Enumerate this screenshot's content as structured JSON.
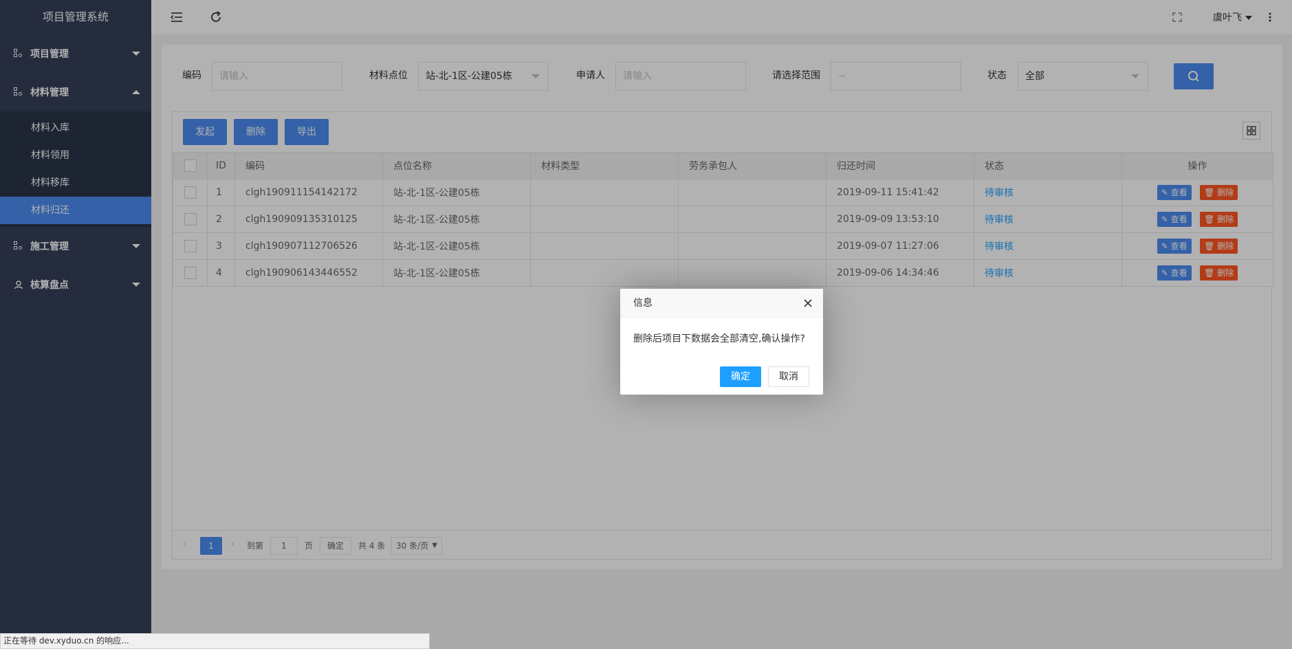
{
  "app": {
    "title": "项目管理系统"
  },
  "sidebar": {
    "groups": [
      {
        "label": "项目管理"
      },
      {
        "label": "材料管理"
      },
      {
        "label": "施工管理"
      },
      {
        "label": "核算盘点"
      }
    ],
    "sub_items": [
      {
        "label": "材料入库"
      },
      {
        "label": "材料领用"
      },
      {
        "label": "材料移库"
      },
      {
        "label": "材料归还"
      }
    ]
  },
  "header": {
    "user": "虞叶飞"
  },
  "filters": {
    "code_label": "编码",
    "code_placeholder": "请输入",
    "location_label": "材料点位",
    "location_value": "站-北-1区-公建05栋",
    "applicant_label": "申请人",
    "applicant_placeholder": "请输入",
    "range_label": "请选择范围",
    "range_placeholder": "~",
    "status_label": "状态",
    "status_value": "全部"
  },
  "toolbar": {
    "start": "发起",
    "delete": "删除",
    "export": "导出"
  },
  "table": {
    "headers": [
      "ID",
      "编码",
      "点位名称",
      "材料类型",
      "劳务承包人",
      "归还时间",
      "状态",
      "操作"
    ],
    "rows": [
      {
        "id": "1",
        "code": "clgh190911154142172",
        "location": "站-北-1区-公建05栋",
        "type": "",
        "contractor": "",
        "time": "2019-09-11 15:41:42",
        "status": "待审核"
      },
      {
        "id": "2",
        "code": "clgh190909135310125",
        "location": "站-北-1区-公建05栋",
        "type": "",
        "contractor": "",
        "time": "2019-09-09 13:53:10",
        "status": "待审核"
      },
      {
        "id": "3",
        "code": "clgh190907112706526",
        "location": "站-北-1区-公建05栋",
        "type": "",
        "contractor": "",
        "time": "2019-09-07 11:27:06",
        "status": "待审核"
      },
      {
        "id": "4",
        "code": "clgh190906143446552",
        "location": "站-北-1区-公建05栋",
        "type": "",
        "contractor": "",
        "time": "2019-09-06 14:34:46",
        "status": "待审核"
      }
    ],
    "view_label": "查看",
    "delete_label": "删除"
  },
  "pager": {
    "current": "1",
    "goto_label": "到第",
    "goto_value": "1",
    "page_unit": "页",
    "confirm": "确定",
    "total": "共 4 条",
    "per_page": "30 条/页"
  },
  "dialog": {
    "title": "信息",
    "message": "删除后项目下数据会全部清空,确认操作?",
    "ok": "确定",
    "cancel": "取消"
  },
  "statusbar": {
    "text": "正在等待 dev.xyduo.cn 的响应..."
  },
  "colors": {
    "sidebar": "#344058",
    "primary": "#4b8cf0",
    "danger": "#ff5722",
    "link": "#1e9fff"
  }
}
